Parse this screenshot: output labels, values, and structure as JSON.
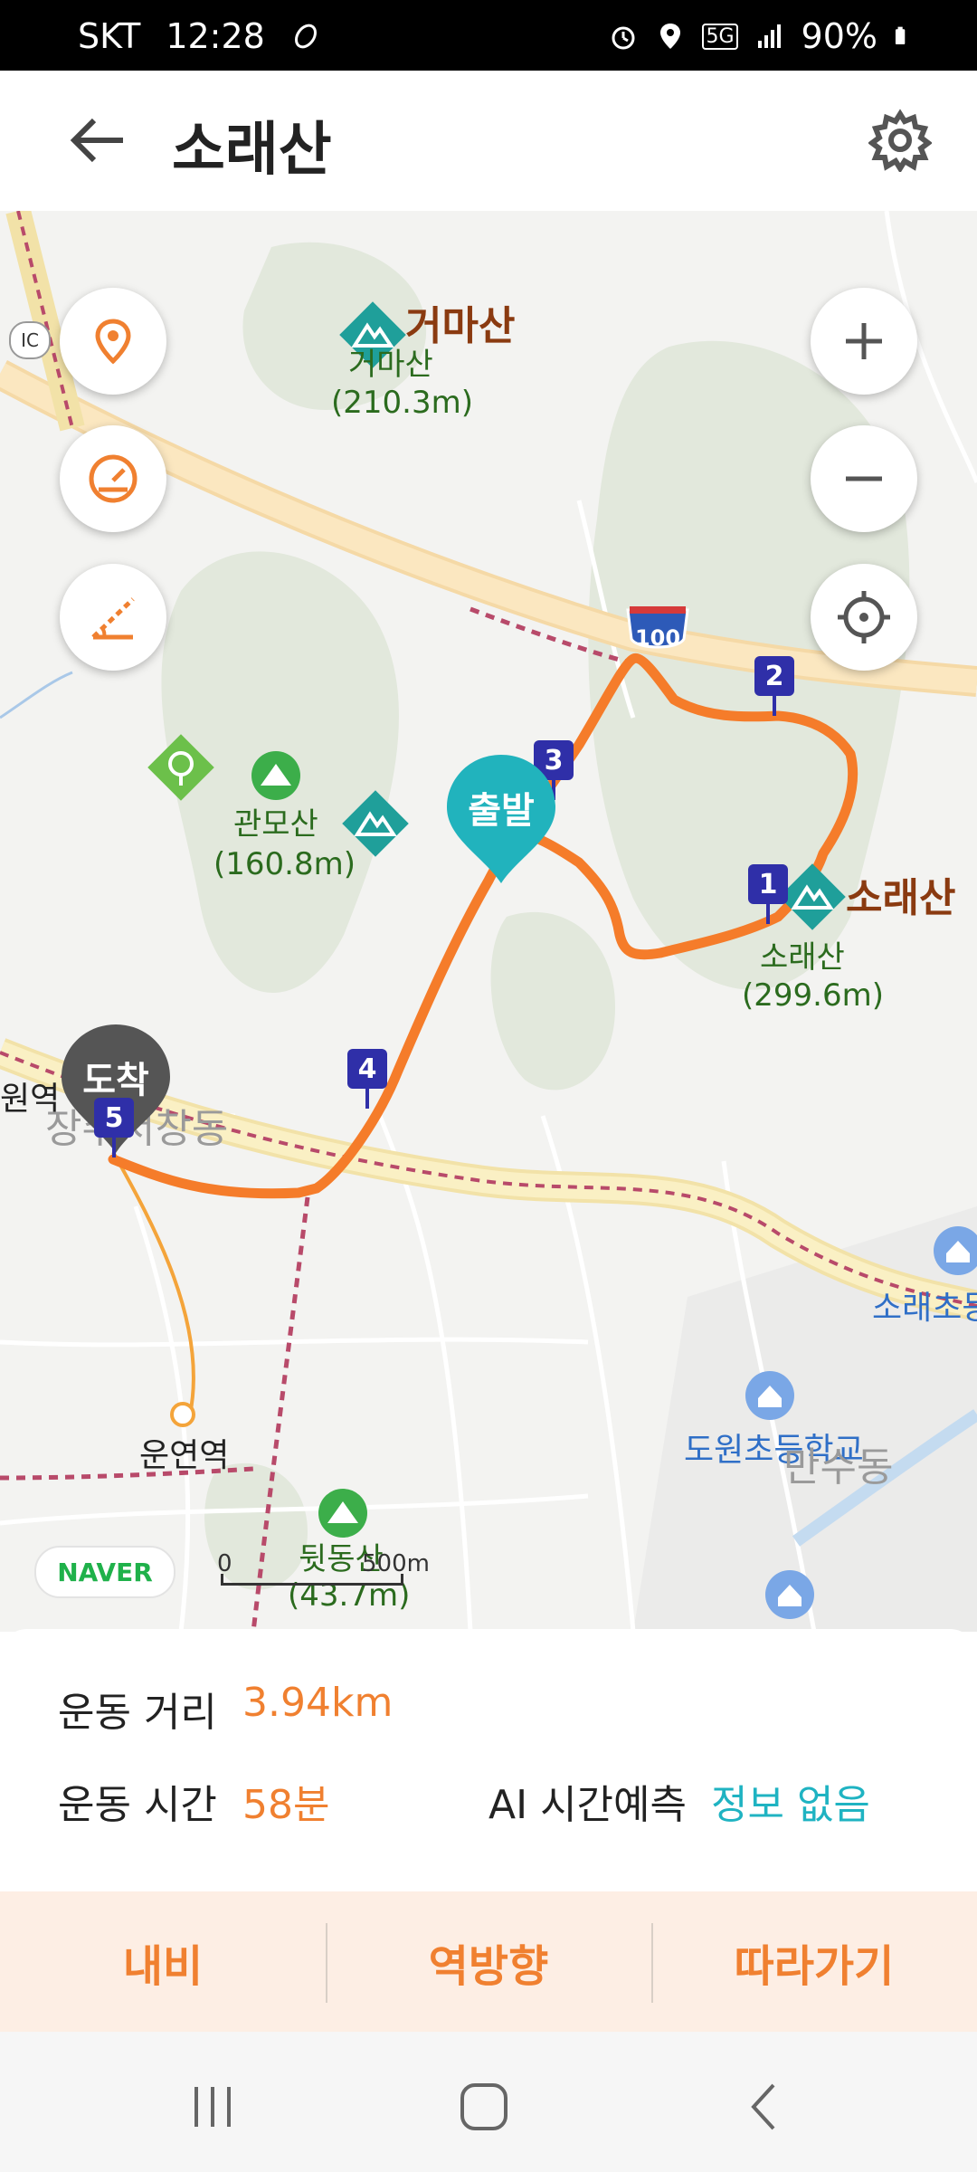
{
  "status_bar": {
    "carrier": "SKT",
    "time": "12:28",
    "network": "5G",
    "battery": "90%"
  },
  "header": {
    "title": "소래산"
  },
  "map": {
    "labels": {
      "geomasan_name": "거마산",
      "geomasan_sub": "거마산",
      "geomasan_height": "(210.3m)",
      "gwanmosan": "관모산",
      "gwanmosan_height": "(160.8m)",
      "soraesan_big": "소래산",
      "soraesan_small": "소래산",
      "soraesan_height": "(299.6m)",
      "dwitdongsan": "뒷동산",
      "dwitdongsan_height": "(43.7m)",
      "dowon_school": "도원초등학교",
      "sorae_school": "소래초등",
      "unyeon_station": "운연역",
      "station_left": "원역",
      "district_left": "장수서창동",
      "district_right": "만수동",
      "highway_number": "100",
      "ic_badge": "IC"
    },
    "start_marker": "출발",
    "end_marker": "도착",
    "waypoints": [
      "1",
      "2",
      "3",
      "4",
      "5"
    ],
    "naver_logo": "NAVER",
    "scale": {
      "zero": "0",
      "distance": "500m"
    },
    "controls": [
      "location-pin",
      "speedometer",
      "measure-angle",
      "zoom-in",
      "zoom-out",
      "gps-locate"
    ]
  },
  "summary": {
    "distance_label": "운동 거리",
    "distance_value": "3.94km",
    "time_label": "운동 시간",
    "time_value": "58분",
    "ai_label": "AI 시간예측",
    "ai_value": "정보 없음"
  },
  "actions": {
    "navi": "내비",
    "reverse": "역방향",
    "follow": "따라가기"
  },
  "colors": {
    "accent": "#f08030",
    "teal": "#1fb3c2",
    "waypoint": "#2f2fa8",
    "route": "#f57c2a"
  }
}
